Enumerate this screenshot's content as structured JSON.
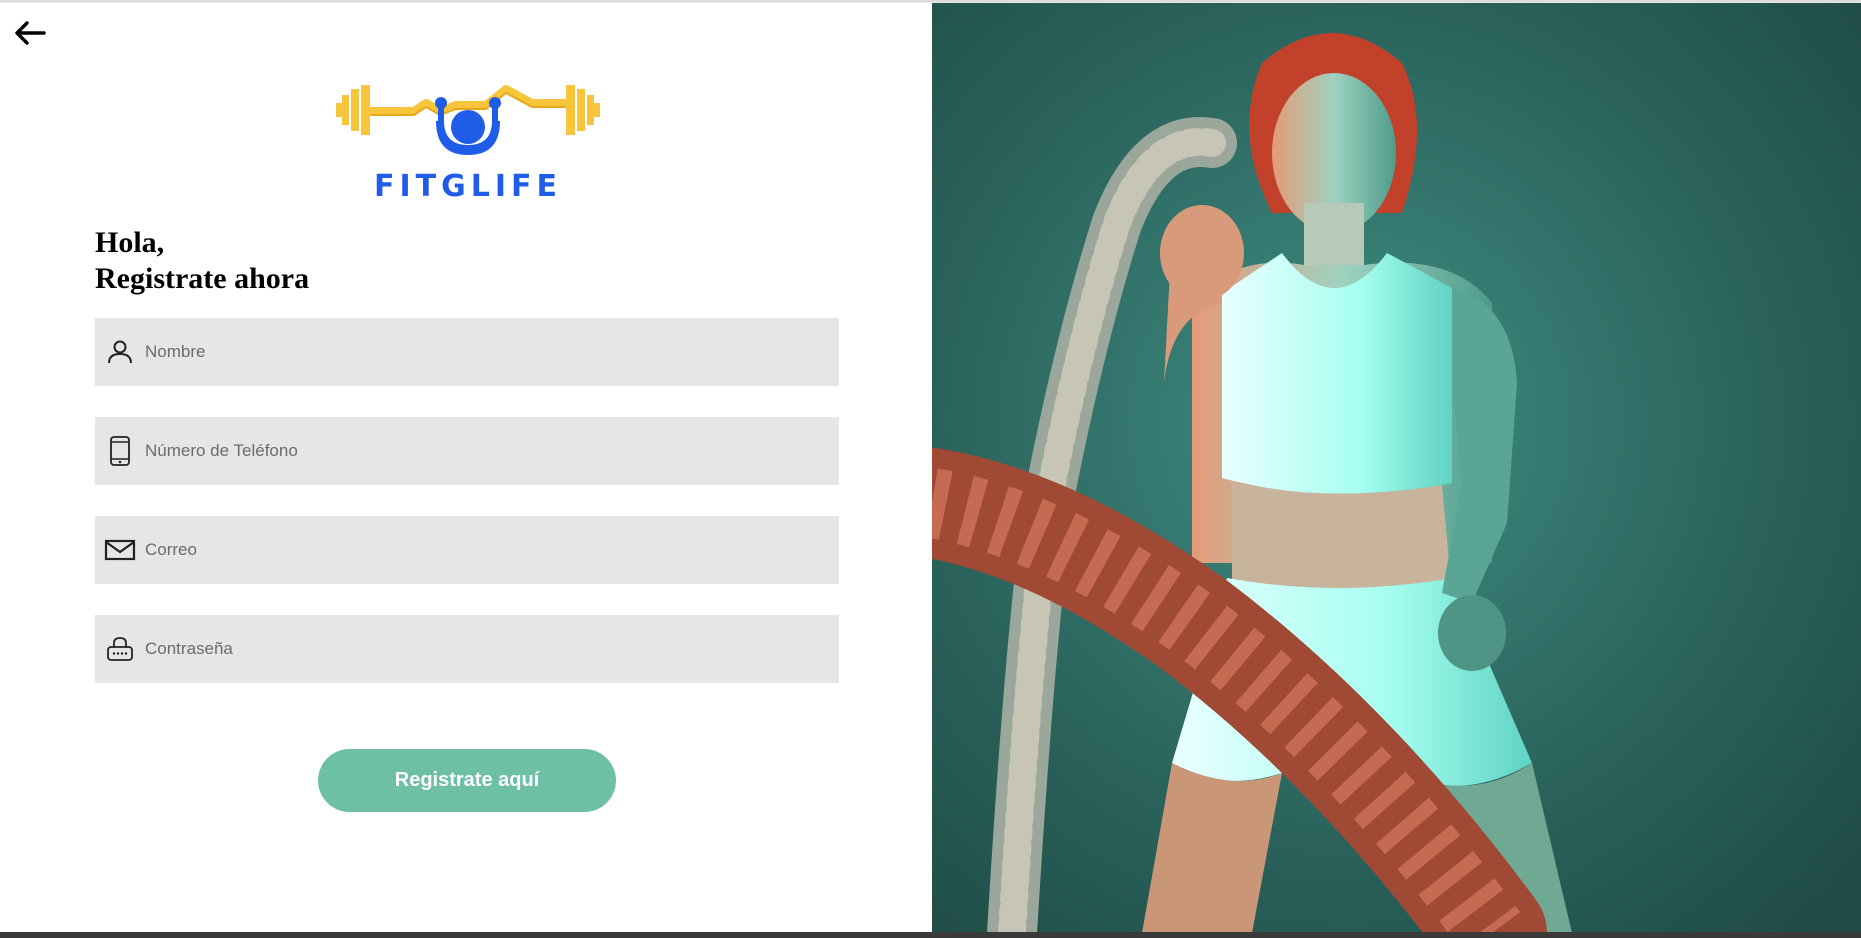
{
  "header": {
    "back_icon": "arrow-left-icon"
  },
  "brand": {
    "name": "FITGLIFE",
    "logo_icon": "barbell-logo-icon",
    "colors": {
      "yellow": "#f7c53b",
      "blue": "#1f5ce8"
    }
  },
  "greeting": {
    "line1": "Hola,",
    "line2": "Registrate ahora"
  },
  "form": {
    "fields": [
      {
        "icon": "user-icon",
        "placeholder": "Nombre",
        "value": ""
      },
      {
        "icon": "phone-icon",
        "placeholder": "Número de Teléfono",
        "value": ""
      },
      {
        "icon": "mail-icon",
        "placeholder": "Correo",
        "value": ""
      },
      {
        "icon": "lock-icon",
        "placeholder": "Contraseña",
        "value": ""
      }
    ],
    "submit_label": "Registrate aquí"
  },
  "colors": {
    "accent": "#6dbfa5",
    "field_bg": "#e6e6e6",
    "photo_bg": "#2c6a62"
  },
  "hero": {
    "image": "fitness-woman-battle-ropes"
  }
}
